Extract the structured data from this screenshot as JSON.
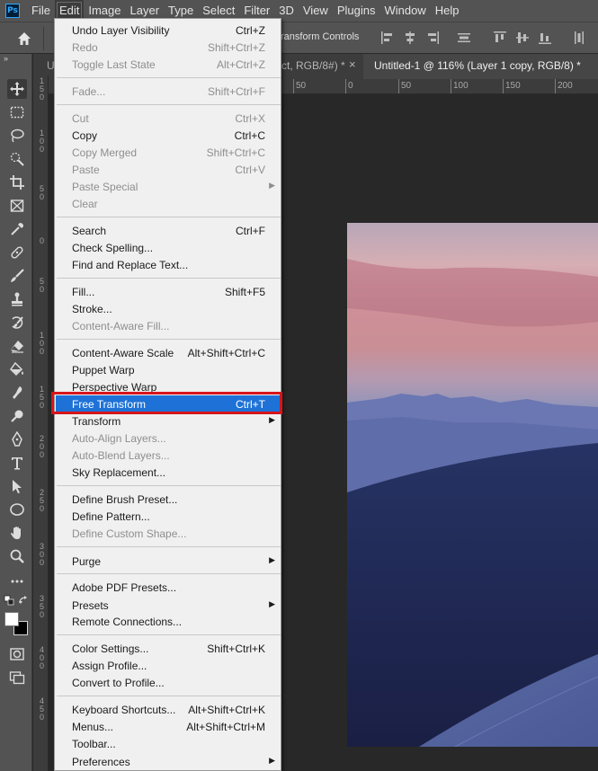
{
  "app": {
    "logo_text": "Ps"
  },
  "menubar": {
    "items": [
      "File",
      "Edit",
      "Image",
      "Layer",
      "Type",
      "Select",
      "Filter",
      "3D",
      "View",
      "Plugins",
      "Window",
      "Help"
    ],
    "active": "Edit"
  },
  "options_bar": {
    "transform_controls_label": "ransform Controls"
  },
  "tabs": {
    "first_label": "U",
    "middle_label": "ct, RGB/8#) *",
    "middle_close": "×",
    "active_label": "Untitled-1 @ 116% (Layer 1 copy, RGB/8) *"
  },
  "rulers": {
    "horizontal": [
      "50",
      "0",
      "50",
      "100",
      "150",
      "200"
    ],
    "vertical": [
      "1\n5\n0",
      "1\n0\n0",
      "5\n0",
      "0",
      "5\n0",
      "1\n0\n0",
      "1\n5\n0",
      "2\n0\n0",
      "2\n5\n0",
      "3\n0\n0",
      "3\n5\n0",
      "4\n0\n0",
      "4\n5\n0"
    ]
  },
  "toolbar": {
    "collapse": "»",
    "tools": [
      "move-tool",
      "marquee-tool",
      "lasso-tool",
      "quick-selection-tool",
      "crop-tool",
      "frame-tool",
      "eyedropper-tool",
      "healing-brush-tool",
      "brush-tool",
      "clone-stamp-tool",
      "history-brush-tool",
      "eraser-tool",
      "paint-bucket-tool",
      "smudge-tool",
      "dodge-tool",
      "pen-tool",
      "type-tool",
      "path-selection-tool",
      "shape-tool",
      "hand-tool",
      "zoom-tool",
      "more-tools"
    ],
    "foreground_color": "#ffffff",
    "background_color": "#000000"
  },
  "edit_menu": {
    "items": [
      {
        "label": "Undo Layer Visibility",
        "shortcut": "Ctrl+Z",
        "enabled": true
      },
      {
        "label": "Redo",
        "shortcut": "Shift+Ctrl+Z",
        "enabled": false
      },
      {
        "label": "Toggle Last State",
        "shortcut": "Alt+Ctrl+Z",
        "enabled": false
      },
      {
        "label": "Fade...",
        "shortcut": "Shift+Ctrl+F",
        "enabled": false
      },
      {
        "label": "Cut",
        "shortcut": "Ctrl+X",
        "enabled": false
      },
      {
        "label": "Copy",
        "shortcut": "Ctrl+C",
        "enabled": true
      },
      {
        "label": "Copy Merged",
        "shortcut": "Shift+Ctrl+C",
        "enabled": false
      },
      {
        "label": "Paste",
        "shortcut": "Ctrl+V",
        "enabled": false
      },
      {
        "label": "Paste Special",
        "shortcut": "",
        "enabled": false,
        "submenu": true
      },
      {
        "label": "Clear",
        "shortcut": "",
        "enabled": false
      },
      {
        "label": "Search",
        "shortcut": "Ctrl+F",
        "enabled": true
      },
      {
        "label": "Check Spelling...",
        "shortcut": "",
        "enabled": true
      },
      {
        "label": "Find and Replace Text...",
        "shortcut": "",
        "enabled": true
      },
      {
        "label": "Fill...",
        "shortcut": "Shift+F5",
        "enabled": true
      },
      {
        "label": "Stroke...",
        "shortcut": "",
        "enabled": true
      },
      {
        "label": "Content-Aware Fill...",
        "shortcut": "",
        "enabled": false
      },
      {
        "label": "Content-Aware Scale",
        "shortcut": "Alt+Shift+Ctrl+C",
        "enabled": true
      },
      {
        "label": "Puppet Warp",
        "shortcut": "",
        "enabled": true
      },
      {
        "label": "Perspective Warp",
        "shortcut": "",
        "enabled": true
      },
      {
        "label": "Free Transform",
        "shortcut": "Ctrl+T",
        "enabled": true,
        "highlighted": true
      },
      {
        "label": "Transform",
        "shortcut": "",
        "enabled": true,
        "submenu": true
      },
      {
        "label": "Auto-Align Layers...",
        "shortcut": "",
        "enabled": false
      },
      {
        "label": "Auto-Blend Layers...",
        "shortcut": "",
        "enabled": false
      },
      {
        "label": "Sky Replacement...",
        "shortcut": "",
        "enabled": true
      },
      {
        "label": "Define Brush Preset...",
        "shortcut": "",
        "enabled": true
      },
      {
        "label": "Define Pattern...",
        "shortcut": "",
        "enabled": true
      },
      {
        "label": "Define Custom Shape...",
        "shortcut": "",
        "enabled": false
      },
      {
        "label": "Purge",
        "shortcut": "",
        "enabled": true,
        "submenu": true
      },
      {
        "label": "Adobe PDF Presets...",
        "shortcut": "",
        "enabled": true
      },
      {
        "label": "Presets",
        "shortcut": "",
        "enabled": true,
        "submenu": true
      },
      {
        "label": "Remote Connections...",
        "shortcut": "",
        "enabled": true
      },
      {
        "label": "Color Settings...",
        "shortcut": "Shift+Ctrl+K",
        "enabled": true
      },
      {
        "label": "Assign Profile...",
        "shortcut": "",
        "enabled": true
      },
      {
        "label": "Convert to Profile...",
        "shortcut": "",
        "enabled": true
      },
      {
        "label": "Keyboard Shortcuts...",
        "shortcut": "Alt+Shift+Ctrl+K",
        "enabled": true
      },
      {
        "label": "Menus...",
        "shortcut": "Alt+Shift+Ctrl+M",
        "enabled": true
      },
      {
        "label": "Toolbar...",
        "shortcut": "",
        "enabled": true
      },
      {
        "label": "Preferences",
        "shortcut": "",
        "enabled": true,
        "submenu": true
      }
    ],
    "submenu_arrow": "▶"
  }
}
